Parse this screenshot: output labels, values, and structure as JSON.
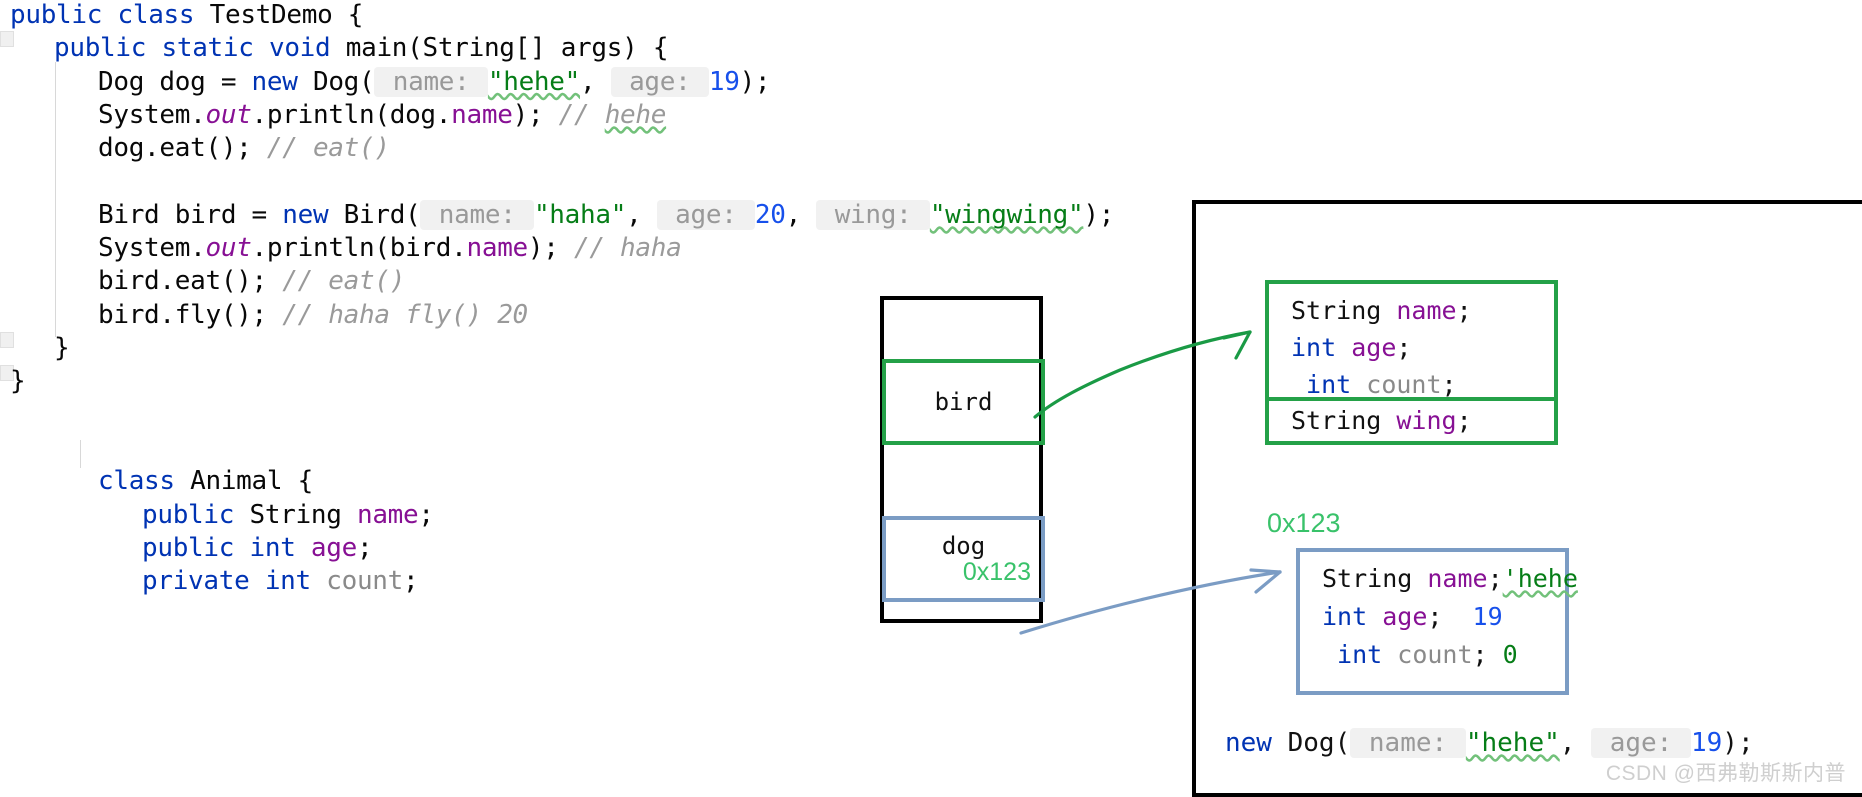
{
  "editor": {
    "code_lines": [
      {
        "indent": 0,
        "tokens": [
          {
            "t": "public ",
            "c": "kw"
          },
          {
            "t": "class ",
            "c": "kw"
          },
          {
            "t": "TestDemo {",
            "c": ""
          }
        ]
      },
      {
        "indent": 1,
        "tokens": [
          {
            "t": "public ",
            "c": "kw"
          },
          {
            "t": "static ",
            "c": "kw"
          },
          {
            "t": "void ",
            "c": "kw"
          },
          {
            "t": "main",
            "c": ""
          },
          {
            "t": "(String[] args) {",
            "c": ""
          }
        ]
      },
      {
        "indent": 2,
        "tokens": [
          {
            "t": "Dog dog = ",
            "c": ""
          },
          {
            "t": "new ",
            "c": "kw"
          },
          {
            "t": "Dog(",
            "c": ""
          },
          {
            "t": " name: ",
            "c": "hint"
          },
          {
            "t": "\"hehe\"",
            "c": "str squig"
          },
          {
            "t": ", ",
            "c": ""
          },
          {
            "t": " age: ",
            "c": "hint"
          },
          {
            "t": "19",
            "c": "num"
          },
          {
            "t": ");",
            "c": ""
          }
        ]
      },
      {
        "indent": 2,
        "tokens": [
          {
            "t": "System.",
            "c": ""
          },
          {
            "t": "out",
            "c": "fld-i"
          },
          {
            "t": ".println(dog.",
            "c": ""
          },
          {
            "t": "name",
            "c": "fld"
          },
          {
            "t": "); ",
            "c": ""
          },
          {
            "t": "// ",
            "c": "cmt"
          },
          {
            "t": "hehe",
            "c": "cmt squig"
          }
        ]
      },
      {
        "indent": 2,
        "tokens": [
          {
            "t": "dog.eat(); ",
            "c": ""
          },
          {
            "t": "// eat()",
            "c": "cmt"
          }
        ]
      },
      {
        "indent": 2,
        "tokens": []
      },
      {
        "indent": 2,
        "tokens": [
          {
            "t": "Bird bird = ",
            "c": ""
          },
          {
            "t": "new ",
            "c": "kw"
          },
          {
            "t": "Bird(",
            "c": ""
          },
          {
            "t": " name: ",
            "c": "hint"
          },
          {
            "t": "\"haha\"",
            "c": "str"
          },
          {
            "t": ", ",
            "c": ""
          },
          {
            "t": " age: ",
            "c": "hint"
          },
          {
            "t": "20",
            "c": "num"
          },
          {
            "t": ", ",
            "c": ""
          },
          {
            "t": " wing: ",
            "c": "hint"
          },
          {
            "t": "\"wingwing\"",
            "c": "str squig"
          },
          {
            "t": ");",
            "c": ""
          }
        ]
      },
      {
        "indent": 2,
        "tokens": [
          {
            "t": "System.",
            "c": ""
          },
          {
            "t": "out",
            "c": "fld-i"
          },
          {
            "t": ".println(bird.",
            "c": ""
          },
          {
            "t": "name",
            "c": "fld"
          },
          {
            "t": "); ",
            "c": ""
          },
          {
            "t": "// haha",
            "c": "cmt"
          }
        ]
      },
      {
        "indent": 2,
        "tokens": [
          {
            "t": "bird.eat(); ",
            "c": ""
          },
          {
            "t": "// eat()",
            "c": "cmt"
          }
        ]
      },
      {
        "indent": 2,
        "tokens": [
          {
            "t": "bird.fly(); ",
            "c": ""
          },
          {
            "t": "// haha fly() 20",
            "c": "cmt"
          }
        ]
      },
      {
        "indent": 1,
        "tokens": [
          {
            "t": "}",
            "c": ""
          }
        ]
      },
      {
        "indent": 0,
        "tokens": [
          {
            "t": "}",
            "c": ""
          }
        ]
      },
      {
        "indent": 0,
        "tokens": []
      },
      {
        "indent": 0,
        "tokens": []
      },
      {
        "indent": 2,
        "tokens": [
          {
            "t": "class ",
            "c": "kw"
          },
          {
            "t": "Animal {",
            "c": ""
          }
        ]
      },
      {
        "indent": 3,
        "tokens": [
          {
            "t": "public ",
            "c": "kw"
          },
          {
            "t": "String ",
            "c": ""
          },
          {
            "t": "name",
            "c": "fld"
          },
          {
            "t": ";",
            "c": ""
          }
        ]
      },
      {
        "indent": 3,
        "tokens": [
          {
            "t": "public ",
            "c": "kw"
          },
          {
            "t": "int ",
            "c": "kw"
          },
          {
            "t": "age",
            "c": "fld"
          },
          {
            "t": ";",
            "c": ""
          }
        ]
      },
      {
        "indent": 3,
        "tokens": [
          {
            "t": "private ",
            "c": "kw"
          },
          {
            "t": "int ",
            "c": "kw"
          },
          {
            "t": "count",
            "c": "gray"
          },
          {
            "t": ";",
            "c": ""
          }
        ]
      }
    ]
  },
  "stack": {
    "title": "stack-diagram",
    "cells": [
      {
        "name": "bird",
        "label": "bird",
        "address": "",
        "color": "#24A148"
      },
      {
        "name": "dog",
        "label": "dog",
        "address": "0x123",
        "color": "#7B9CC4"
      }
    ]
  },
  "heap": {
    "bird_object": {
      "inherited_fields": [
        [
          {
            "t": "String ",
            "c": ""
          },
          {
            "t": "name",
            "c": "fld"
          },
          {
            "t": ";",
            "c": ""
          }
        ],
        [
          {
            "t": "int ",
            "c": "kw"
          },
          {
            "t": "age",
            "c": "fld"
          },
          {
            "t": ";",
            "c": ""
          }
        ],
        [
          {
            "t": " int ",
            "c": "kw"
          },
          {
            "t": "count",
            "c": "gray"
          },
          {
            "t": ";",
            "c": ""
          }
        ]
      ],
      "own_fields": [
        [
          {
            "t": "String ",
            "c": ""
          },
          {
            "t": "wing",
            "c": "fld"
          },
          {
            "t": ";",
            "c": ""
          }
        ]
      ]
    },
    "dog_object": {
      "address": "0x123",
      "fields": [
        [
          {
            "t": "String ",
            "c": ""
          },
          {
            "t": "name",
            "c": "fld"
          },
          {
            "t": ";",
            "c": ""
          },
          {
            "t": "'hehe",
            "c": "str squig"
          }
        ],
        [
          {
            "t": "int ",
            "c": "kw"
          },
          {
            "t": "age",
            "c": "fld"
          },
          {
            "t": ";  ",
            "c": ""
          },
          {
            "t": "19",
            "c": "num"
          }
        ],
        [
          {
            "t": " int ",
            "c": "kw"
          },
          {
            "t": "count",
            "c": "gray"
          },
          {
            "t": "; ",
            "c": ""
          },
          {
            "t": "0",
            "c": "str"
          }
        ]
      ]
    },
    "footer_line": [
      {
        "t": "new ",
        "c": "kw"
      },
      {
        "t": "Dog(",
        "c": ""
      },
      {
        "t": " name: ",
        "c": "hint"
      },
      {
        "t": "\"hehe\"",
        "c": "str squig"
      },
      {
        "t": ", ",
        "c": ""
      },
      {
        "t": " age: ",
        "c": "hint"
      },
      {
        "t": "19",
        "c": "num"
      },
      {
        "t": ");",
        "c": ""
      }
    ]
  },
  "watermark": {
    "text": "CSDN @西弗勒斯斯内普"
  },
  "colors": {
    "keyword": "#0033B3",
    "string": "#067D17",
    "number": "#1750EB",
    "field": "#871094",
    "comment": "#9A9A9A",
    "green_box": "#24A148",
    "blue_box": "#7B9CC4",
    "address_green": "#39c26a"
  }
}
